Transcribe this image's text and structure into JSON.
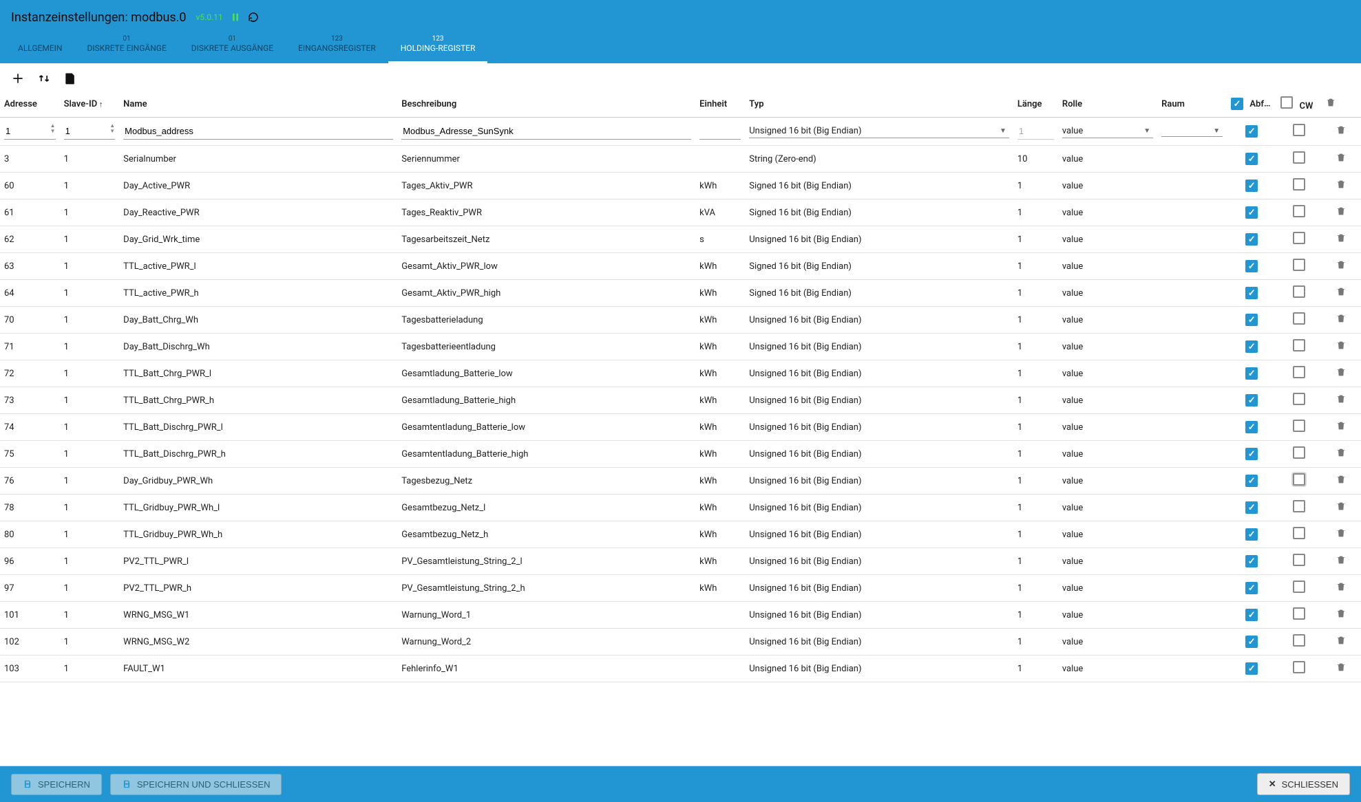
{
  "header": {
    "title": "Instanzeinstellungen: modbus.0",
    "version": "v5.0.11"
  },
  "tabs": [
    {
      "super": "",
      "label": "ALLGEMEIN",
      "active": false
    },
    {
      "super": "01",
      "label": "DISKRETE EINGÄNGE",
      "active": false
    },
    {
      "super": "01",
      "label": "DISKRETE AUSGÄNGE",
      "active": false
    },
    {
      "super": "123",
      "label": "EINGANGSREGISTER",
      "active": false
    },
    {
      "super": "123",
      "label": "HOLDING-REGISTER",
      "active": true
    }
  ],
  "cols": {
    "addr": "Adresse",
    "slave": "Slave-ID",
    "name": "Name",
    "desc": "Beschreibung",
    "unit": "Einheit",
    "type": "Typ",
    "len": "Länge",
    "role": "Rolle",
    "room": "Raum",
    "abf": "Abfrage",
    "cw": "CW"
  },
  "edit_row": {
    "addr": "1",
    "slave": "1",
    "name": "Modbus_address",
    "desc": "Modbus_Adresse_SunSynk",
    "unit": "",
    "type": "Unsigned 16 bit (Big Endian)",
    "len": "1",
    "role": "value",
    "room": "",
    "abf": true,
    "cw": false
  },
  "rows": [
    {
      "addr": "3",
      "slave": "1",
      "name": "Serialnumber",
      "desc": "Seriennummer",
      "unit": "",
      "type": "String (Zero-end)",
      "len": "10",
      "role": "value",
      "abf": true,
      "cw": false
    },
    {
      "addr": "60",
      "slave": "1",
      "name": "Day_Active_PWR",
      "desc": "Tages_Aktiv_PWR",
      "unit": "kWh",
      "type": "Signed 16 bit (Big Endian)",
      "len": "1",
      "role": "value",
      "abf": true,
      "cw": false
    },
    {
      "addr": "61",
      "slave": "1",
      "name": "Day_Reactive_PWR",
      "desc": "Tages_Reaktiv_PWR",
      "unit": "kVA",
      "type": "Signed 16 bit (Big Endian)",
      "len": "1",
      "role": "value",
      "abf": true,
      "cw": false
    },
    {
      "addr": "62",
      "slave": "1",
      "name": "Day_Grid_Wrk_time",
      "desc": "Tagesarbeitszeit_Netz",
      "unit": "s",
      "type": "Unsigned 16 bit (Big Endian)",
      "len": "1",
      "role": "value",
      "abf": true,
      "cw": false
    },
    {
      "addr": "63",
      "slave": "1",
      "name": "TTL_active_PWR_l",
      "desc": "Gesamt_Aktiv_PWR_low",
      "unit": "kWh",
      "type": "Signed 16 bit (Big Endian)",
      "len": "1",
      "role": "value",
      "abf": true,
      "cw": false
    },
    {
      "addr": "64",
      "slave": "1",
      "name": "TTL_active_PWR_h",
      "desc": "Gesamt_Aktiv_PWR_high",
      "unit": "kWh",
      "type": "Signed 16 bit (Big Endian)",
      "len": "1",
      "role": "value",
      "abf": true,
      "cw": false
    },
    {
      "addr": "70",
      "slave": "1",
      "name": "Day_Batt_Chrg_Wh",
      "desc": "Tagesbatterieladung",
      "unit": "kWh",
      "type": "Unsigned 16 bit (Big Endian)",
      "len": "1",
      "role": "value",
      "abf": true,
      "cw": false
    },
    {
      "addr": "71",
      "slave": "1",
      "name": "Day_Batt_Dischrg_Wh",
      "desc": "Tagesbatterieentladung",
      "unit": "kWh",
      "type": "Unsigned 16 bit (Big Endian)",
      "len": "1",
      "role": "value",
      "abf": true,
      "cw": false
    },
    {
      "addr": "72",
      "slave": "1",
      "name": "TTL_Batt_Chrg_PWR_l",
      "desc": "Gesamtladung_Batterie_low",
      "unit": "kWh",
      "type": "Unsigned 16 bit (Big Endian)",
      "len": "1",
      "role": "value",
      "abf": true,
      "cw": false
    },
    {
      "addr": "73",
      "slave": "1",
      "name": "TTL_Batt_Chrg_PWR_h",
      "desc": "Gesamtladung_Batterie_high",
      "unit": "kWh",
      "type": "Unsigned 16 bit (Big Endian)",
      "len": "1",
      "role": "value",
      "abf": true,
      "cw": false
    },
    {
      "addr": "74",
      "slave": "1",
      "name": "TTL_Batt_Dischrg_PWR_l",
      "desc": "Gesamtentladung_Batterie_low",
      "unit": "kWh",
      "type": "Unsigned 16 bit (Big Endian)",
      "len": "1",
      "role": "value",
      "abf": true,
      "cw": false
    },
    {
      "addr": "75",
      "slave": "1",
      "name": "TTL_Batt_Dischrg_PWR_h",
      "desc": "Gesamtentladung_Batterie_high",
      "unit": "kWh",
      "type": "Unsigned 16 bit (Big Endian)",
      "len": "1",
      "role": "value",
      "abf": true,
      "cw": false
    },
    {
      "addr": "76",
      "slave": "1",
      "name": "Day_Gridbuy_PWR_Wh",
      "desc": "Tagesbezug_Netz",
      "unit": "kWh",
      "type": "Unsigned 16 bit (Big Endian)",
      "len": "1",
      "role": "value",
      "abf": true,
      "cw": false,
      "cw_focus": true
    },
    {
      "addr": "78",
      "slave": "1",
      "name": "TTL_Gridbuy_PWR_Wh_l",
      "desc": "Gesamtbezug_Netz_l",
      "unit": "kWh",
      "type": "Unsigned 16 bit (Big Endian)",
      "len": "1",
      "role": "value",
      "abf": true,
      "cw": false
    },
    {
      "addr": "80",
      "slave": "1",
      "name": "TTL_Gridbuy_PWR_Wh_h",
      "desc": "Gesamtbezug_Netz_h",
      "unit": "kWh",
      "type": "Unsigned 16 bit (Big Endian)",
      "len": "1",
      "role": "value",
      "abf": true,
      "cw": false
    },
    {
      "addr": "96",
      "slave": "1",
      "name": "PV2_TTL_PWR_l",
      "desc": "PV_Gesamtleistung_String_2_l",
      "unit": "kWh",
      "type": "Unsigned 16 bit (Big Endian)",
      "len": "1",
      "role": "value",
      "abf": true,
      "cw": false
    },
    {
      "addr": "97",
      "slave": "1",
      "name": "PV2_TTL_PWR_h",
      "desc": "PV_Gesamtleistung_String_2_h",
      "unit": "kWh",
      "type": "Unsigned 16 bit (Big Endian)",
      "len": "1",
      "role": "value",
      "abf": true,
      "cw": false
    },
    {
      "addr": "101",
      "slave": "1",
      "name": "WRNG_MSG_W1",
      "desc": "Warnung_Word_1",
      "unit": "",
      "type": "Unsigned 16 bit (Big Endian)",
      "len": "1",
      "role": "value",
      "abf": true,
      "cw": false
    },
    {
      "addr": "102",
      "slave": "1",
      "name": "WRNG_MSG_W2",
      "desc": "Warnung_Word_2",
      "unit": "",
      "type": "Unsigned 16 bit (Big Endian)",
      "len": "1",
      "role": "value",
      "abf": true,
      "cw": false
    },
    {
      "addr": "103",
      "slave": "1",
      "name": "FAULT_W1",
      "desc": "Fehlerinfo_W1",
      "unit": "",
      "type": "Unsigned 16 bit (Big Endian)",
      "len": "1",
      "role": "value",
      "abf": true,
      "cw": false
    }
  ],
  "footer": {
    "save": "SPEICHERN",
    "save_close": "SPEICHERN UND SCHLIESSEN",
    "close": "SCHLIESSEN"
  }
}
